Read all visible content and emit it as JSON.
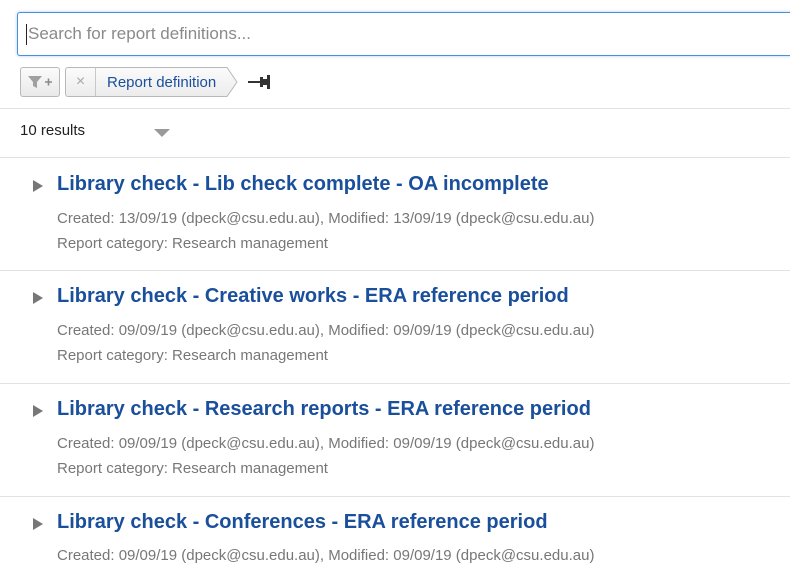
{
  "search": {
    "placeholder": "Search for report definitions..."
  },
  "filters": {
    "add_filter_icon": "filter-plus-icon",
    "chip_remove_symbol": "×",
    "chip_label": "Report definition",
    "pin_icon": "pin-icon"
  },
  "results": {
    "count_label": "10 results",
    "items": [
      {
        "title": "Library check - Lib check complete - OA incomplete",
        "meta": "Created: 13/09/19 (dpeck@csu.edu.au), Modified: 13/09/19 (dpeck@csu.edu.au)",
        "category": "Report category: Research management"
      },
      {
        "title": "Library check - Creative works - ERA reference period",
        "meta": "Created: 09/09/19 (dpeck@csu.edu.au), Modified: 09/09/19 (dpeck@csu.edu.au)",
        "category": "Report category: Research management"
      },
      {
        "title": "Library check - Research reports - ERA reference period",
        "meta": "Created: 09/09/19 (dpeck@csu.edu.au), Modified: 09/09/19 (dpeck@csu.edu.au)",
        "category": "Report category: Research management"
      },
      {
        "title": "Library check - Conferences - ERA reference period",
        "meta": "Created: 09/09/19 (dpeck@csu.edu.au), Modified: 09/09/19 (dpeck@csu.edu.au)",
        "category": ""
      }
    ]
  },
  "colors": {
    "link_blue": "#1a4f9c",
    "meta_grey": "#777777",
    "focus_border": "#4a8fd9"
  }
}
